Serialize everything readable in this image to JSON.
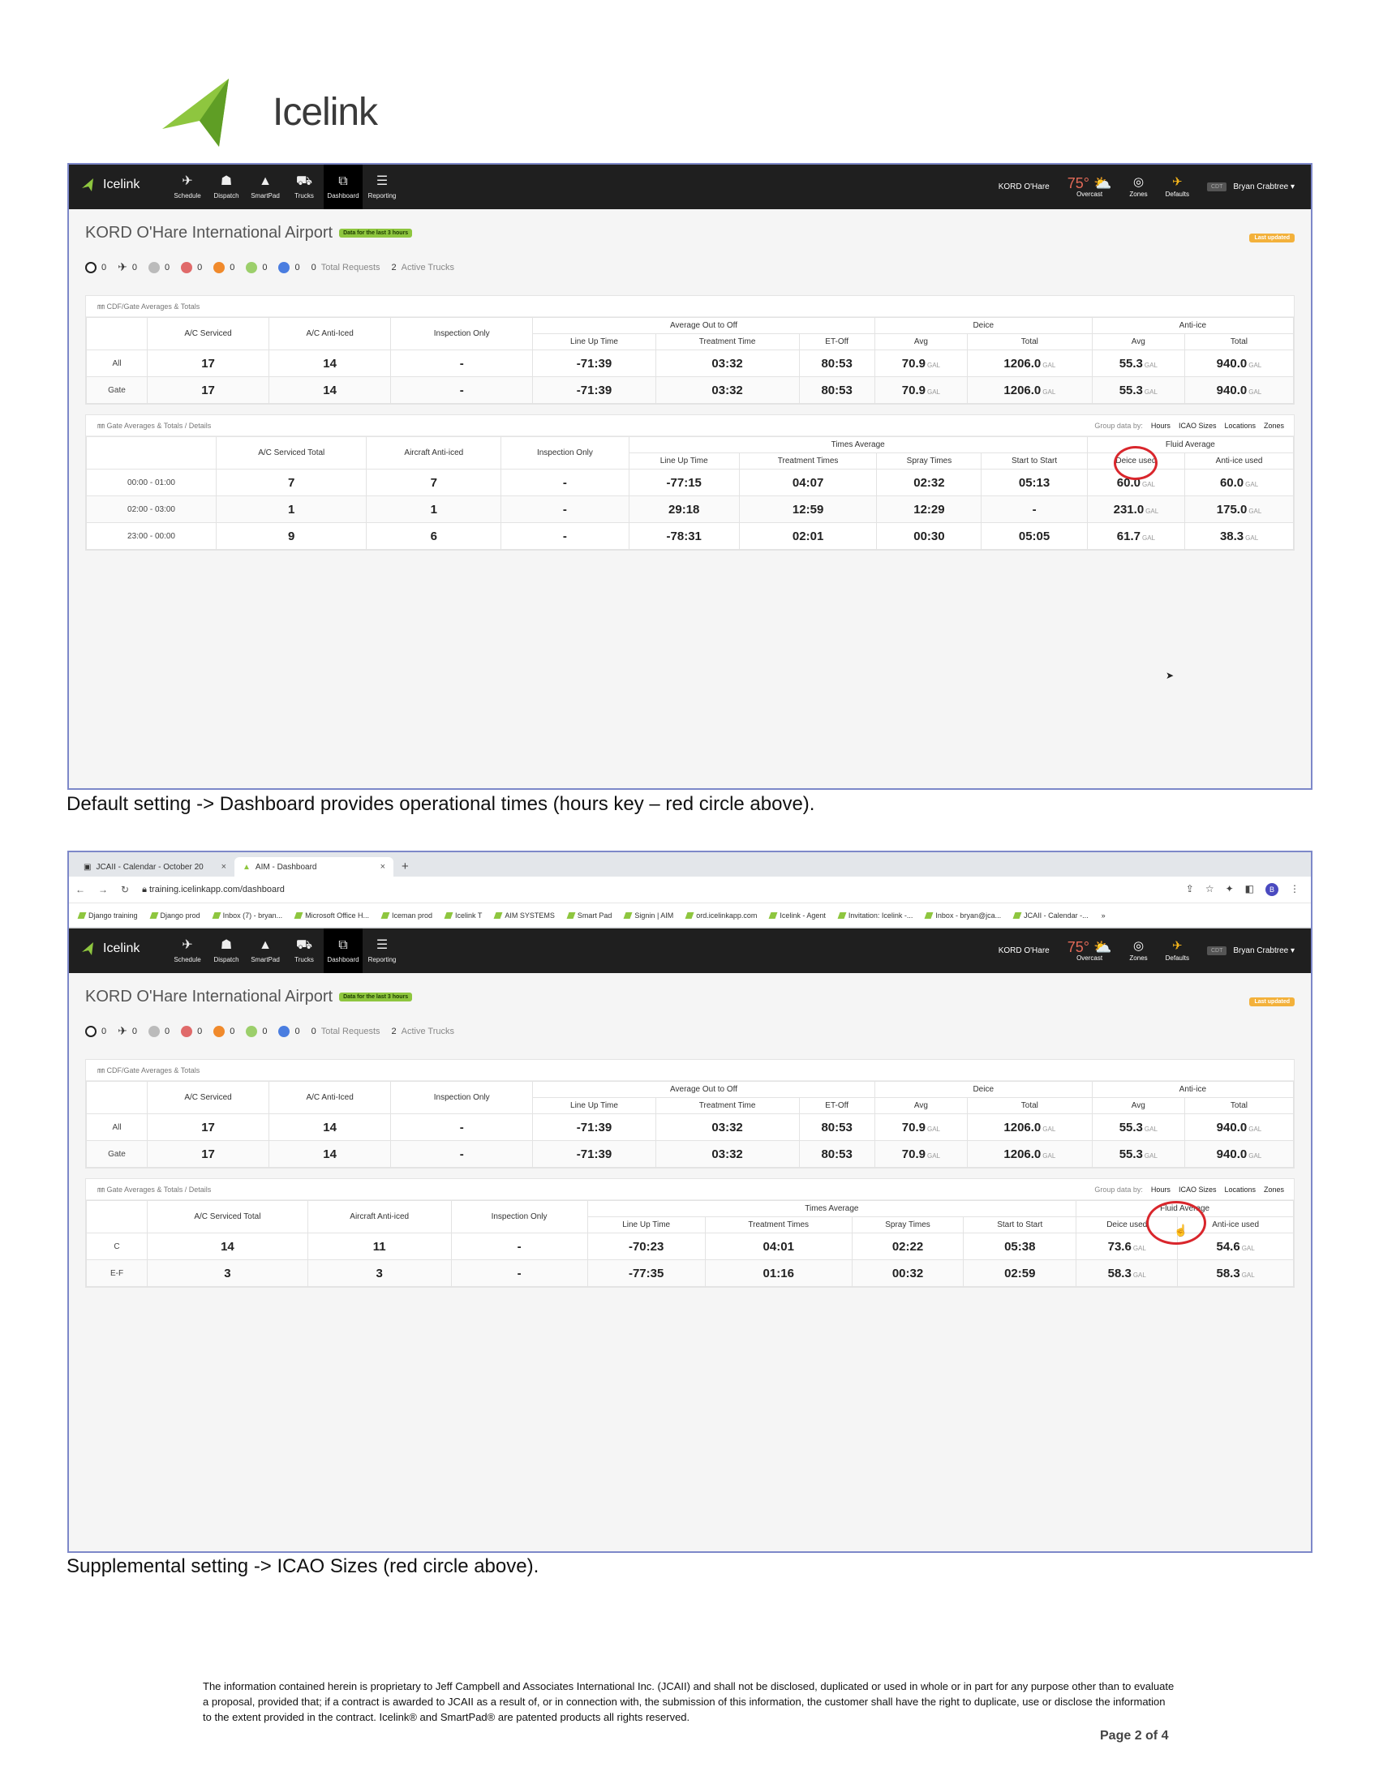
{
  "doc": {
    "logo_text": "Icelink",
    "caption1": "Default setting -> Dashboard provides operational times (hours key – red circle above).",
    "caption2": "Supplemental setting -> ICAO Sizes (red circle above).",
    "footer": "The information contained herein is proprietary to Jeff Campbell and Associates International Inc. (JCAII) and shall not be disclosed, duplicated or used in whole or in part for any purpose other than to evaluate a proposal, provided that; if a contract is awarded to JCAII as a result of, or in connection with, the submission of this information, the customer shall have the right to duplicate, use or disclose the information to the extent provided in the contract. Icelink® and SmartPad® are patented products all rights reserved.",
    "page_number": "Page 2 of 4"
  },
  "browser": {
    "tabs": [
      {
        "label": "JCAII - Calendar - October 20",
        "close": "×"
      },
      {
        "label": "AIM - Dashboard",
        "close": "×"
      }
    ],
    "new_tab": "+",
    "url": "training.icelinkapp.com/dashboard",
    "avatar": "B",
    "bookmarks": [
      "Django training",
      "Django prod",
      "Inbox (7) - bryan...",
      "Microsoft Office H...",
      "Iceman prod",
      "Icelink T",
      "AIM SYSTEMS",
      "Smart Pad",
      "Signin | AIM",
      "ord.icelinkapp.com",
      "Icelink - Agent",
      "Invitation: Icelink -...",
      "Inbox - bryan@jca...",
      "JCAII - Calendar -...",
      "»"
    ]
  },
  "app": {
    "brand": "Icelink",
    "nav": [
      {
        "label": "Schedule",
        "icon": "✈"
      },
      {
        "label": "Dispatch",
        "icon": "☗"
      },
      {
        "label": "SmartPad",
        "icon": "▲"
      },
      {
        "label": "Trucks",
        "icon": "⛟"
      },
      {
        "label": "Dashboard",
        "icon": "⧉"
      },
      {
        "label": "Reporting",
        "icon": "☰"
      }
    ],
    "airport_short": "KORD O'Hare",
    "temperature": "75°",
    "weather": "Overcast",
    "zones": "Zones",
    "defaults": "Defaults",
    "tz": "CDT",
    "user": "Bryan Crabtree ▾",
    "page_title": "KORD O'Hare International Airport",
    "data_badge": "Data for the last 3 hours",
    "last_updated": "Last updated",
    "status": [
      {
        "value": "0",
        "color": "hollow"
      },
      {
        "value": "0",
        "color": "plane"
      },
      {
        "value": "0",
        "color": "#bbbbbb"
      },
      {
        "value": "0",
        "color": "#e06a6a"
      },
      {
        "value": "0",
        "color": "#f08a2c"
      },
      {
        "value": "0",
        "color": "#9ccf6b"
      },
      {
        "value": "0",
        "color": "#4a7de0"
      }
    ],
    "total_requests_value": "0",
    "total_requests_label": "Total Requests",
    "active_trucks_value": "2",
    "active_trucks_label": "Active Trucks"
  },
  "cdf": {
    "heading": "CDF/Gate Averages & Totals",
    "groups": [
      "Average Out to Off",
      "Deice",
      "Anti-ice"
    ],
    "headers": [
      "A/C Serviced",
      "A/C Anti-Iced",
      "Inspection Only"
    ],
    "subheaders": [
      "Line Up Time",
      "Treatment Time",
      "ET-Off",
      "Avg",
      "Total",
      "Avg",
      "Total"
    ],
    "unit": "GAL",
    "rows": [
      {
        "label": "All",
        "cells": [
          "17",
          "14",
          "-",
          "-71:39",
          "03:32",
          "80:53",
          "70.9",
          "1206.0",
          "55.3",
          "940.0"
        ]
      },
      {
        "label": "Gate",
        "cells": [
          "17",
          "14",
          "-",
          "-71:39",
          "03:32",
          "80:53",
          "70.9",
          "1206.0",
          "55.3",
          "940.0"
        ]
      }
    ]
  },
  "gate": {
    "heading": "Gate Averages & Totals / Details",
    "group_by_label": "Group data by:",
    "group_by_options": [
      "Hours",
      "ICAO Sizes",
      "Locations",
      "Zones"
    ],
    "group_times": "Times Average",
    "group_fluid": "Fluid Average",
    "headers": [
      "A/C Serviced Total",
      "Aircraft Anti-iced",
      "Inspection Only"
    ],
    "subheaders": [
      "Line Up Time",
      "Treatment Times",
      "Spray Times",
      "Start to Start",
      "Deice used",
      "Anti-ice used"
    ],
    "unit": "GAL",
    "rows_hours": [
      {
        "label": "00:00 - 01:00",
        "cells": [
          "7",
          "7",
          "-",
          "-77:15",
          "04:07",
          "02:32",
          "05:13",
          "60.0",
          "60.0"
        ]
      },
      {
        "label": "02:00 - 03:00",
        "cells": [
          "1",
          "1",
          "-",
          "29:18",
          "12:59",
          "12:29",
          "-",
          "231.0",
          "175.0"
        ]
      },
      {
        "label": "23:00 - 00:00",
        "cells": [
          "9",
          "6",
          "-",
          "-78:31",
          "02:01",
          "00:30",
          "05:05",
          "61.7",
          "38.3"
        ]
      }
    ],
    "rows_icao": [
      {
        "label": "C",
        "cells": [
          "14",
          "11",
          "-",
          "-70:23",
          "04:01",
          "02:22",
          "05:38",
          "73.6",
          "54.6"
        ]
      },
      {
        "label": "E-F",
        "cells": [
          "3",
          "3",
          "-",
          "-77:35",
          "01:16",
          "00:32",
          "02:59",
          "58.3",
          "58.3"
        ]
      }
    ]
  }
}
